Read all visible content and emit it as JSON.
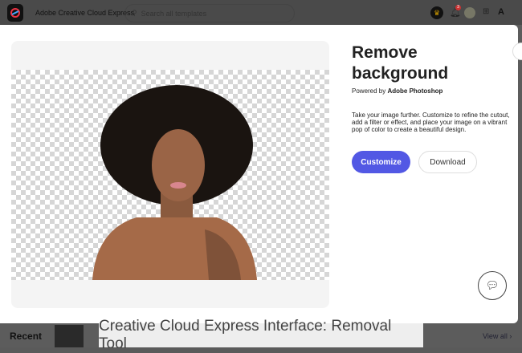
{
  "topbar": {
    "app_title": "Adobe Creative Cloud Express",
    "search_placeholder": "Search all templates",
    "notification_count": "3"
  },
  "modal": {
    "title": "Remove background",
    "powered_prefix": "Powered by ",
    "powered_brand": "Adobe Photoshop",
    "description": "Take your image further. Customize to refine the cutout, add a filter or effect, and place your image on a vibrant pop of color to create a beautiful design.",
    "customize_label": "Customize",
    "download_label": "Download"
  },
  "bottom": {
    "recent_label": "Recent",
    "view_all_label": "View all ›",
    "caption": "Creative Cloud Express Interface: Removal Tool"
  },
  "colors": {
    "accent": "#5258e4"
  }
}
